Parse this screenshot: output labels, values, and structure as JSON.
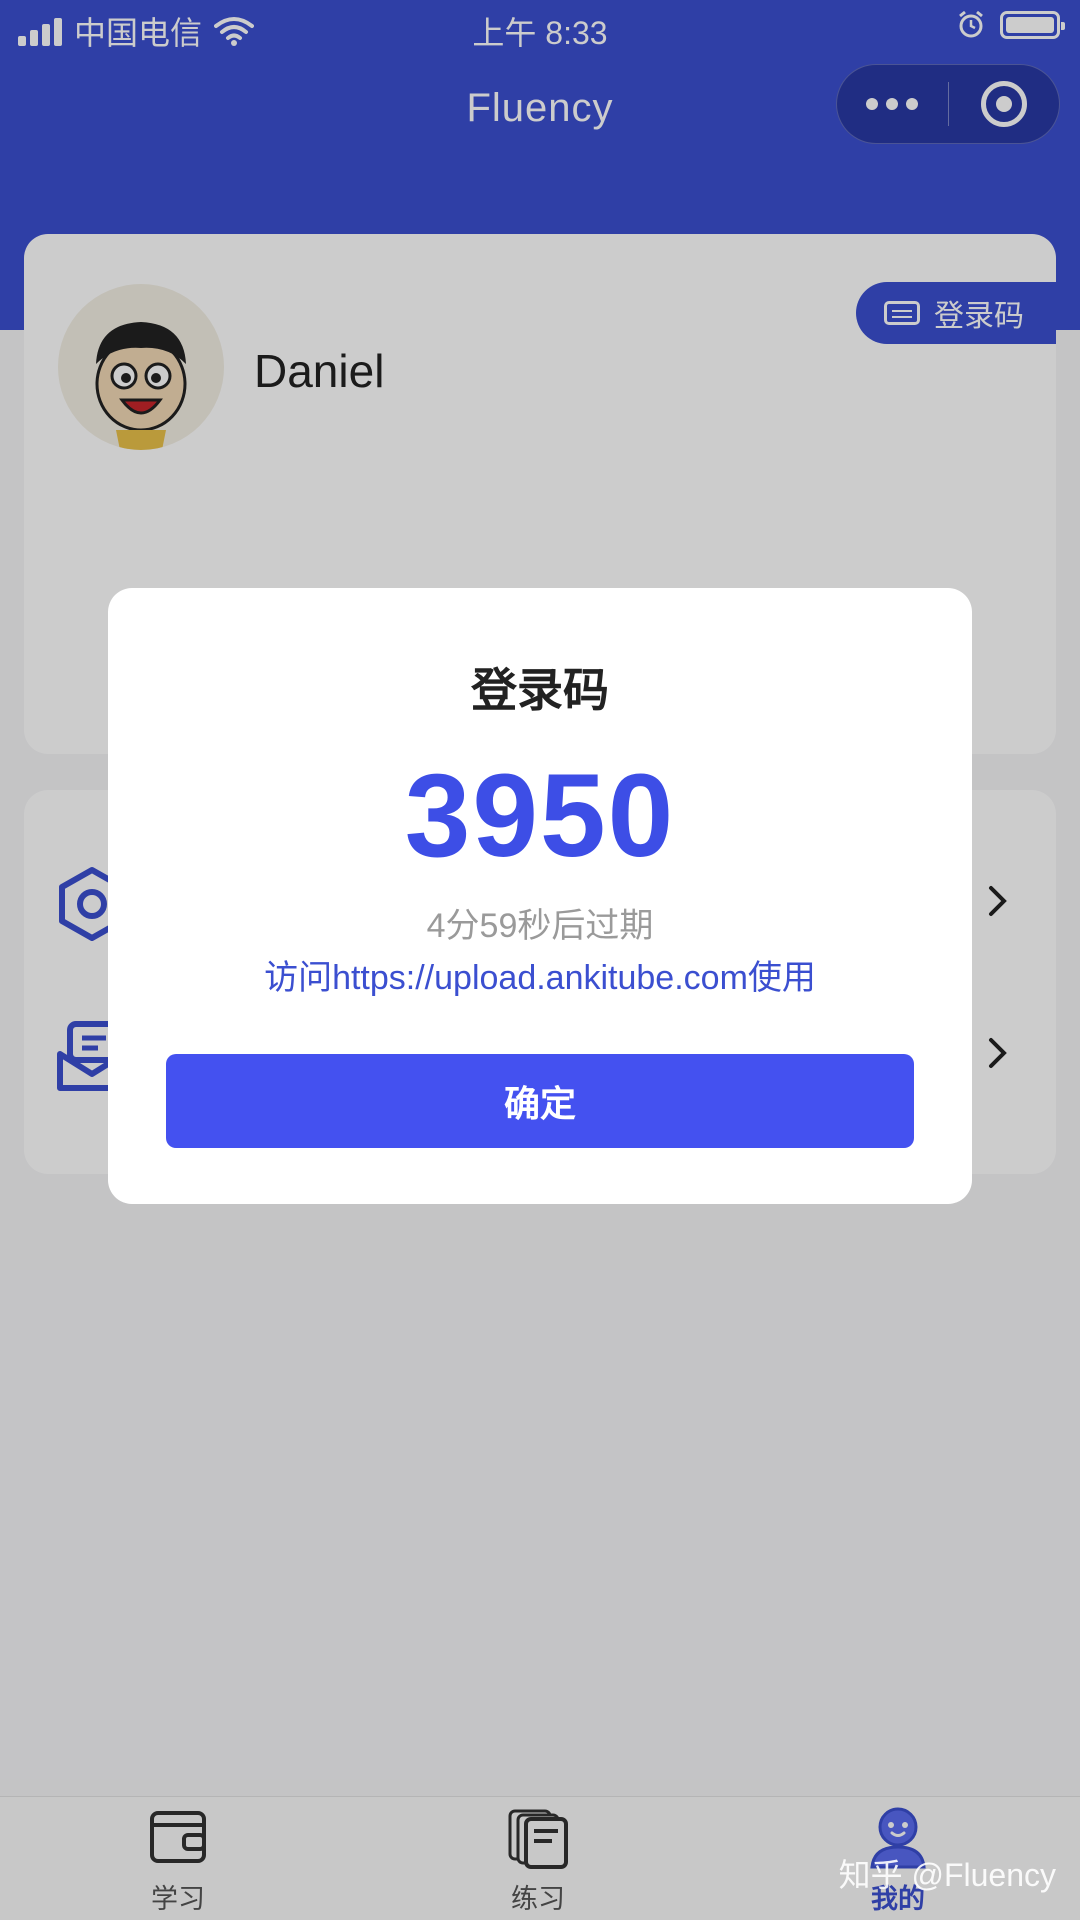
{
  "status_bar": {
    "carrier": "中国电信",
    "time": "上午 8:33",
    "icons": [
      "signal-icon",
      "wifi-icon",
      "alarm-icon",
      "battery-icon"
    ]
  },
  "nav": {
    "title": "Fluency",
    "more_icon": "more-dots-icon",
    "close_icon": "target-icon"
  },
  "profile": {
    "username": "Daniel",
    "avatar_icon": "cartoon-avatar",
    "login_code_button": "登录码",
    "login_code_icon": "keyboard-icon"
  },
  "menu": {
    "items": [
      {
        "icon": "settings-hexagon-icon"
      },
      {
        "icon": "message-envelope-icon"
      }
    ]
  },
  "dialog": {
    "title": "登录码",
    "code": "3950",
    "expire_text": "4分59秒后过期",
    "url_text": "访问https://upload.ankitube.com使用",
    "confirm_label": "确定"
  },
  "tabbar": {
    "tabs": [
      {
        "label": "学习",
        "icon": "wallet-icon",
        "active": false
      },
      {
        "label": "练习",
        "icon": "cards-icon",
        "active": false
      },
      {
        "label": "我的",
        "icon": "user-icon",
        "active": true
      }
    ]
  },
  "watermark": "知乎 @Fluency",
  "colors": {
    "brand": "#3b4fd0",
    "accent": "#4451f0",
    "code": "#3d4ee6"
  }
}
